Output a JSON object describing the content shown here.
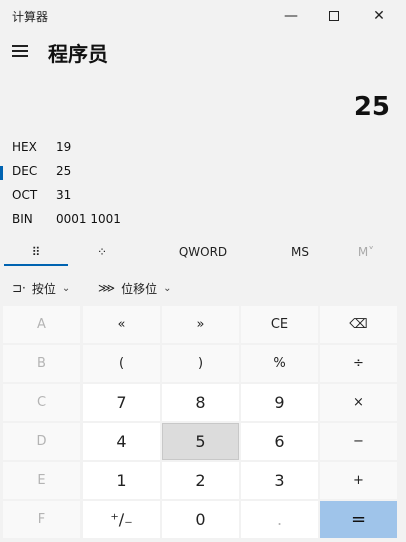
{
  "window": {
    "title": "计算器",
    "minimize_glyph": "—",
    "close_glyph": "✕"
  },
  "header": {
    "mode": "程序员",
    "menu_icon": "hamburger-menu-icon"
  },
  "display": {
    "value": "25"
  },
  "radix": [
    {
      "label": "HEX",
      "value": "19",
      "active": false
    },
    {
      "label": "DEC",
      "value": "25",
      "active": true
    },
    {
      "label": "OCT",
      "value": "31",
      "active": false
    },
    {
      "label": "BIN",
      "value": "0001 1001",
      "active": false
    }
  ],
  "tabs": {
    "keypad_icon": "⠿",
    "bitpad_icon": "⁘",
    "word_size": "QWORD",
    "memory_store": "MS",
    "memory_list": "M˅"
  },
  "ops": {
    "bitwise_icon": "⊐·",
    "bitwise_label": "按位",
    "shift_icon": "⋙",
    "shift_label": "位移位",
    "chevron": "⌄"
  },
  "keys": {
    "a": "A",
    "lshift": "«",
    "rshift": "»",
    "ce": "CE",
    "backspace": "⌫",
    "b": "B",
    "lparen": "(",
    "rparen": ")",
    "percent": "%",
    "divide": "÷",
    "c": "C",
    "seven": "7",
    "eight": "8",
    "nine": "9",
    "multiply": "×",
    "d": "D",
    "four": "4",
    "five": "5",
    "six": "6",
    "minus": "−",
    "e": "E",
    "one": "1",
    "two": "2",
    "three": "3",
    "plus": "+",
    "f": "F",
    "negate": "⁺∕₋",
    "zero": "0",
    "decimal": ".",
    "equals": "="
  },
  "colors": {
    "accent": "#0063b1",
    "equals_bg": "#9fc4ea",
    "background": "#f2f2f2"
  }
}
